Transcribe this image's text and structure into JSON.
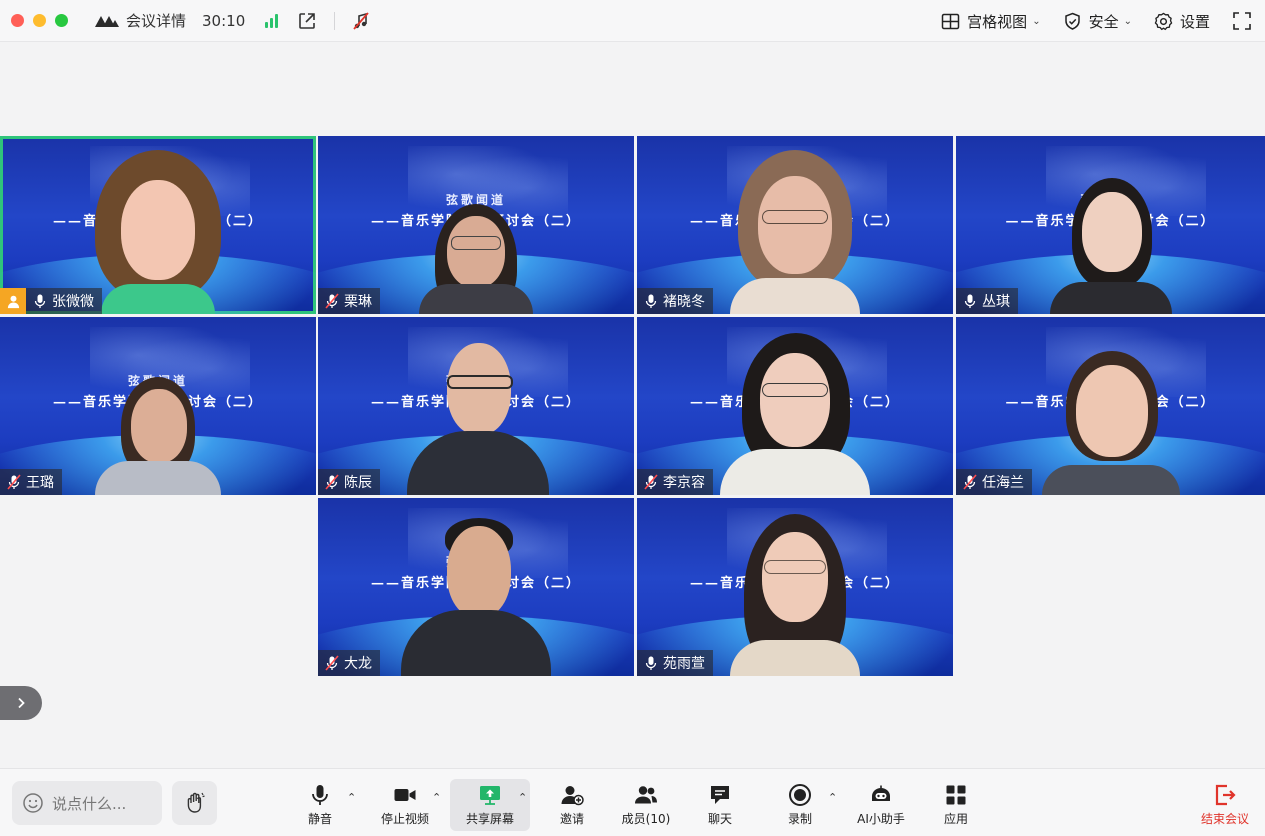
{
  "topbar": {
    "meeting_details": "会议详情",
    "timer": "30:10",
    "grid_view": "宫格视图",
    "security": "安全",
    "settings": "设置"
  },
  "banner": {
    "title_small": "弦歌闻道",
    "title_main": "——音乐学院教学研讨会（二）"
  },
  "participants": [
    {
      "name": "张微微",
      "muted": false,
      "host": true
    },
    {
      "name": "栗琳",
      "muted": true,
      "host": false
    },
    {
      "name": "褚晓冬",
      "muted": false,
      "host": false
    },
    {
      "name": "丛琪",
      "muted": false,
      "host": false
    },
    {
      "name": "王璐",
      "muted": true,
      "host": false
    },
    {
      "name": "陈辰",
      "muted": true,
      "host": false
    },
    {
      "name": "李京容",
      "muted": true,
      "host": false
    },
    {
      "name": "任海兰",
      "muted": true,
      "host": false
    },
    {
      "name": "大龙",
      "muted": true,
      "host": false
    },
    {
      "name": "苑雨萱",
      "muted": false,
      "host": false
    }
  ],
  "toolbar": {
    "chat_placeholder": "说点什么...",
    "mute": "静音",
    "stop_video": "停止视频",
    "share_screen": "共享屏幕",
    "invite": "邀请",
    "members": "成员(10)",
    "chat": "聊天",
    "record": "录制",
    "ai_assistant": "AI小助手",
    "apps": "应用",
    "end_meeting": "结束会议"
  },
  "colors": {
    "active_speaker": "#2fc47b",
    "signal": "#2ac36c",
    "end_meeting": "#e0342b",
    "host_badge": "#f5a623"
  }
}
